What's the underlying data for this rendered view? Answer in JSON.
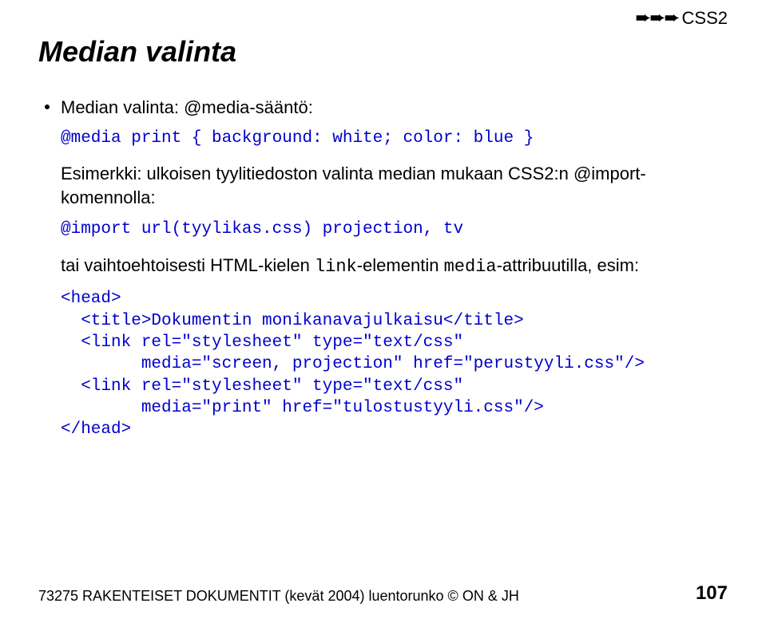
{
  "header": {
    "arrows": "➨➨➨",
    "tag": "CSS2"
  },
  "title": "Median valinta",
  "bullet": {
    "text": "Median valinta: @media-sääntö:"
  },
  "code1": "@media print { background: white; color: blue }",
  "para1_a": "Esimerkki: ulkoisen tyylitiedoston valinta median mukaan CSS2:n @import-komennolla:",
  "code2": "@import url(tyylikas.css) projection, tv",
  "para2_a": "tai vaihtoehtoisesti HTML-kielen ",
  "para2_code1": "link",
  "para2_b": "-elementin ",
  "para2_code2": "media",
  "para2_c": "-attribuutilla, esim:",
  "code3": "<head>\n  <title>Dokumentin monikanavajulkaisu</title>\n  <link rel=\"stylesheet\" type=\"text/css\"\n        media=\"screen, projection\" href=\"perustyyli.css\"/>\n  <link rel=\"stylesheet\" type=\"text/css\"\n        media=\"print\" href=\"tulostustyyli.css\"/>\n</head>",
  "footer": {
    "left": "73275 RAKENTEISET DOKUMENTIT (kevät 2004) luentorunko © ON & JH",
    "page": "107"
  }
}
